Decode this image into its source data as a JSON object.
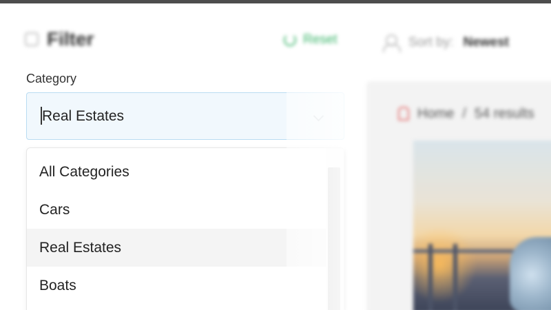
{
  "header": {
    "filter_label": "Filter",
    "reset_label": "Reset",
    "sort_label": "Sort by:",
    "sort_value": "Newest"
  },
  "category": {
    "label": "Category",
    "selected": "Real Estates",
    "options": [
      {
        "label": "All Categories"
      },
      {
        "label": "Cars"
      },
      {
        "label": "Real Estates",
        "selected": true
      },
      {
        "label": "Boats"
      }
    ]
  },
  "results": {
    "breadcrumb_home": "Home",
    "breadcrumb_sep": "/",
    "results_count": "54 results"
  },
  "colors": {
    "accent_green": "#3bb56a",
    "select_bg": "#f1f8fd",
    "select_border": "#b9dcf2",
    "selected_option_bg": "#f4f4f4"
  }
}
